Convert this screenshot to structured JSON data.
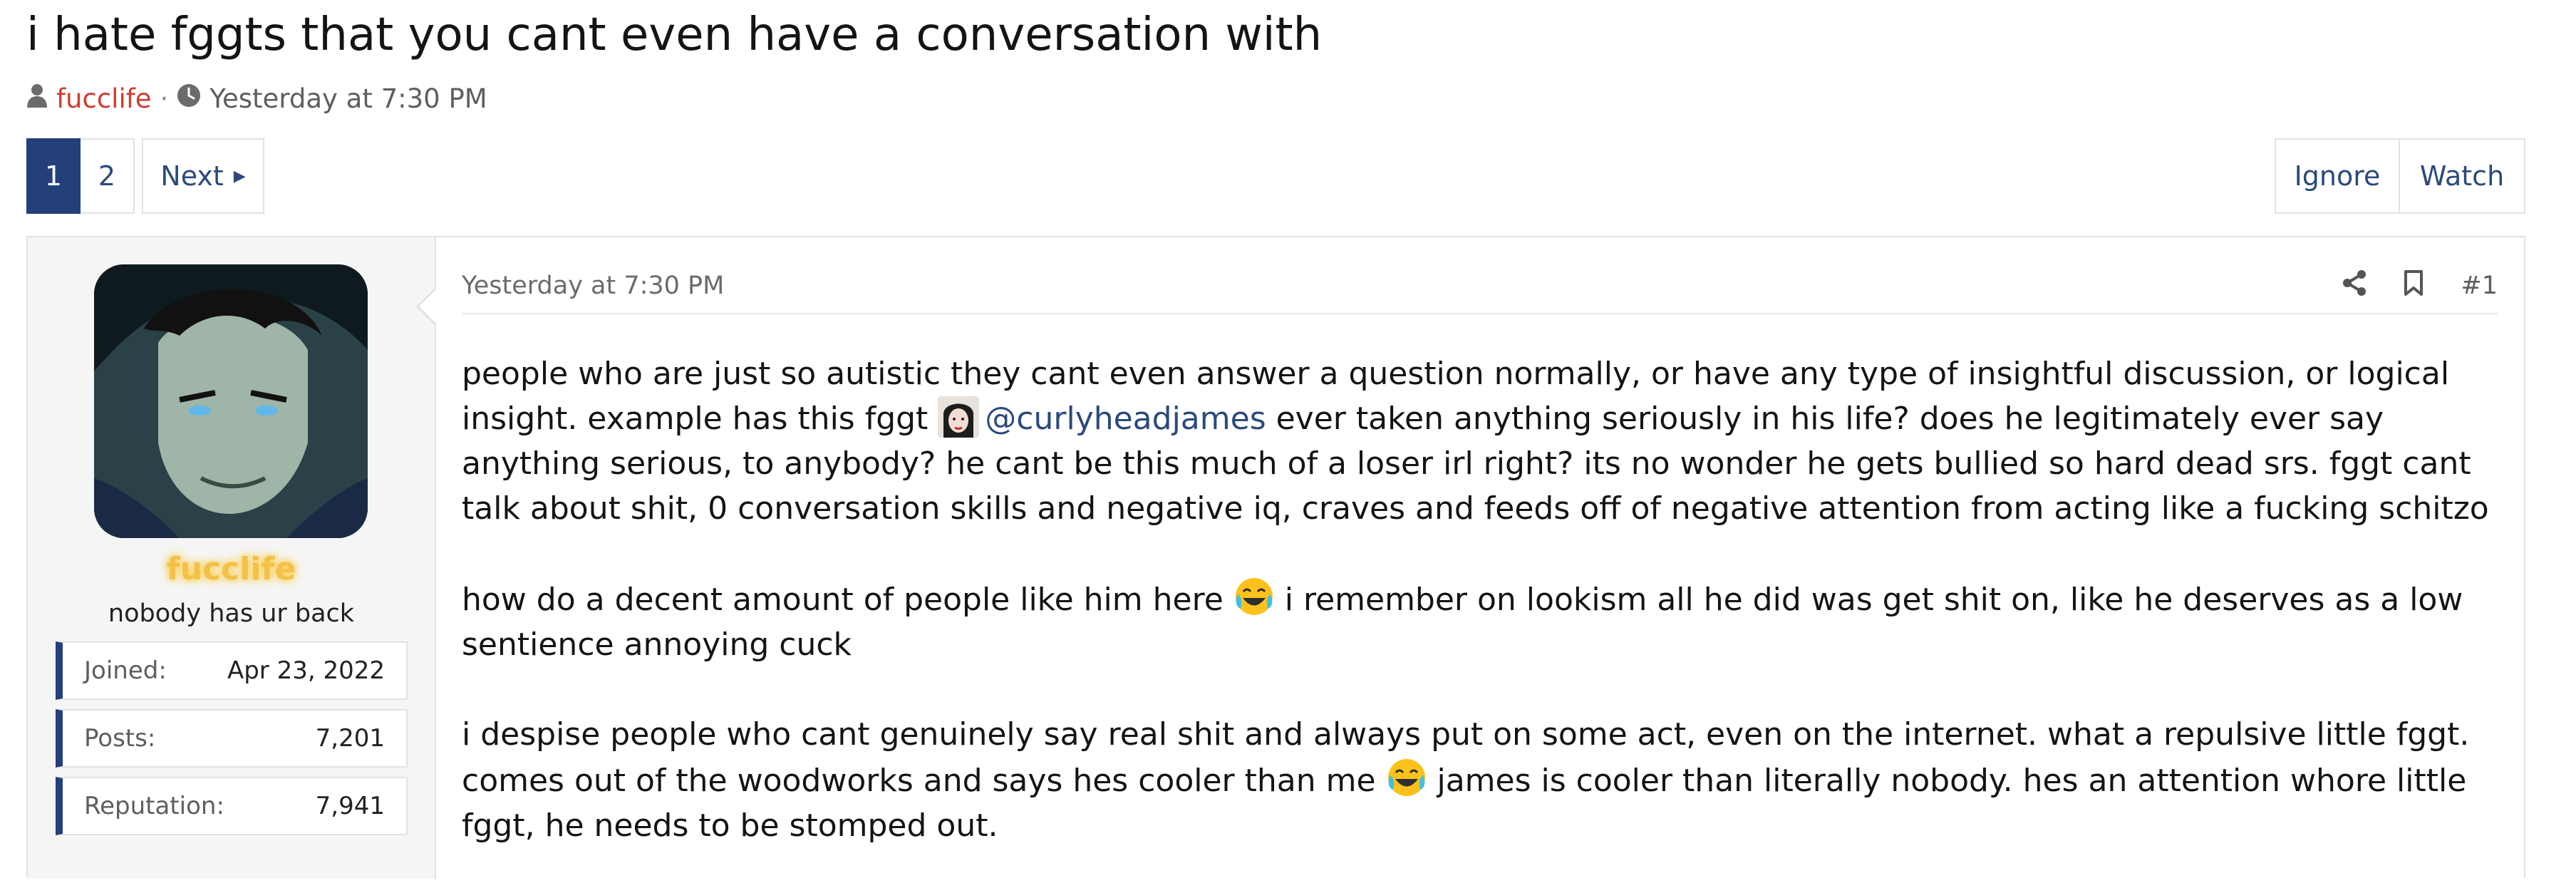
{
  "thread": {
    "title": "i hate fggts that you cant even have a conversation with",
    "author": "fucclife",
    "separator": "·",
    "date": "Yesterday at 7:30 PM"
  },
  "pagination": {
    "current": "1",
    "page2": "2",
    "next": "Next"
  },
  "thread_actions": {
    "ignore": "Ignore",
    "watch": "Watch"
  },
  "user": {
    "name": "fucclife",
    "title": "nobody has ur back",
    "stats": [
      {
        "label": "Joined:",
        "value": "Apr 23, 2022"
      },
      {
        "label": "Posts:",
        "value": "7,201"
      },
      {
        "label": "Reputation:",
        "value": "7,941"
      }
    ]
  },
  "post": {
    "date": "Yesterday at 7:30 PM",
    "number": "#1",
    "p1_a": "people who are just so autistic they cant even answer a question normally, or have any type of insightful discussion, or logical insight. example has this fggt ",
    "mention": "@curlyheadjames",
    "p1_b": " ever taken anything seriously in his life? does he legitimately ever say anything serious, to anybody? he cant be this much of a loser irl right? its no wonder he gets bullied so hard dead srs. fggt cant talk about shit, 0 conversation skills and negative iq, craves and feeds off of negative attention from acting like a fucking schitzo",
    "p2_a": "how do a decent amount of people like him here ",
    "p2_b": " i remember on lookism all he did was get shit on, like he deserves as a low sentience annoying cuck",
    "p3_a": "i despise people who cant genuinely say real shit and always put on some act, even on the internet. what a repulsive little fggt. comes out of the woodworks and says hes cooler than me ",
    "p3_b": " james is cooler than literally nobody. hes an attention whore little fggt, he needs to be stomped out."
  },
  "colors": {
    "accent": "#23407a",
    "link": "#2b4a7a",
    "username_red": "#d03c2f",
    "username_gold": "#f2c14a"
  }
}
